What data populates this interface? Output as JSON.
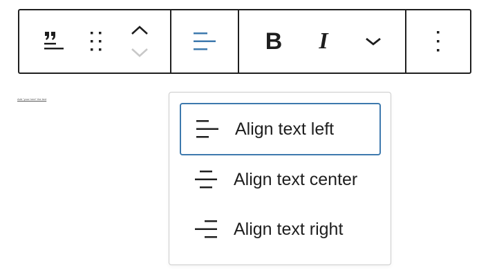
{
  "toolbar": {
    "block_type": {
      "icon": "quote-icon"
    },
    "drag_handle": {
      "icon": "drag-handle-icon"
    },
    "move_up": {
      "icon": "chevron-up-icon"
    },
    "move_down": {
      "icon": "chevron-down-icon",
      "disabled": true
    },
    "align": {
      "icon": "align-left-icon",
      "color": "#3d79ad"
    },
    "bold": {
      "label": "B"
    },
    "italic": {
      "label": "I"
    },
    "more_formatting": {
      "icon": "chevron-down-icon"
    },
    "options": {
      "icon": "more-vertical-icon"
    }
  },
  "canvas": {
    "tiny_text": "Add \"your here\" the text"
  },
  "align_menu": {
    "items": [
      {
        "label": "Align text left",
        "icon": "align-left-icon",
        "selected": true
      },
      {
        "label": "Align text center",
        "icon": "align-center-icon",
        "selected": false
      },
      {
        "label": "Align text right",
        "icon": "align-right-icon",
        "selected": false
      }
    ],
    "selected_border_color": "#3d79ad"
  }
}
